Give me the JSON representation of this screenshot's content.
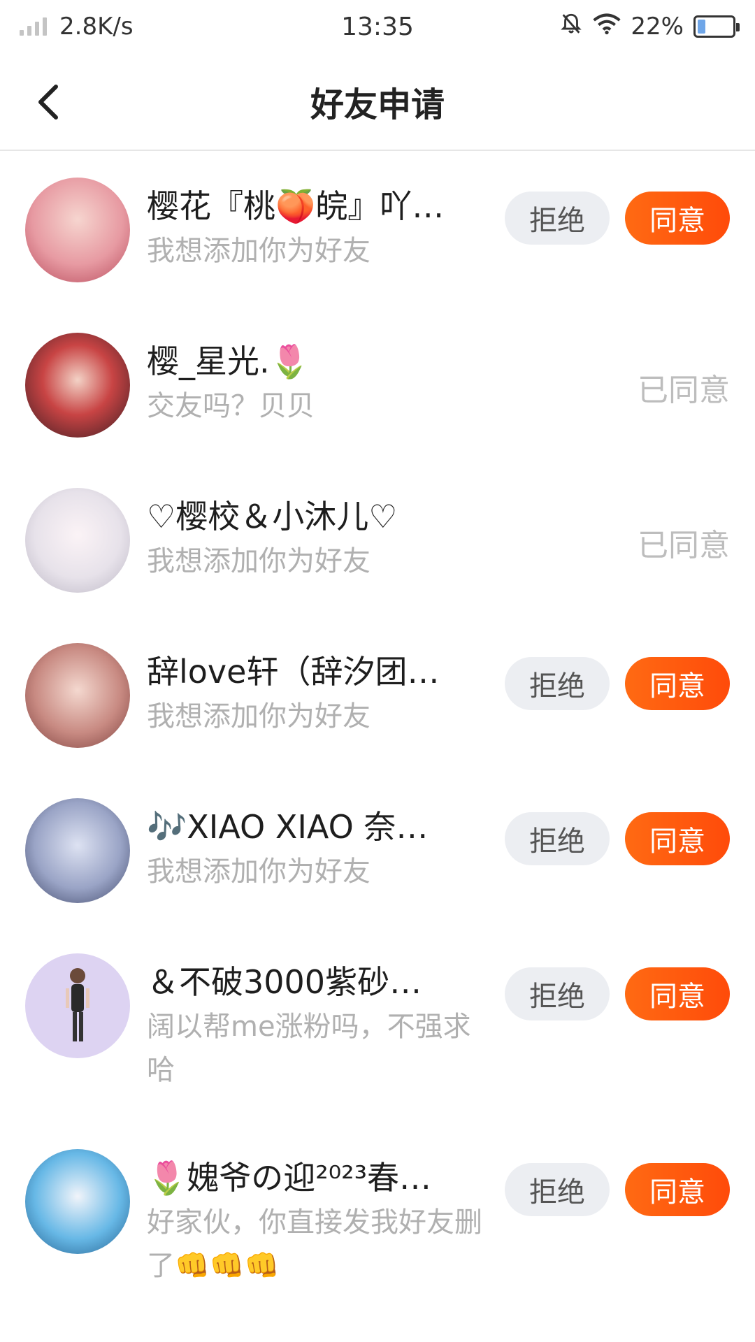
{
  "status_bar": {
    "net_speed": "2.8K/s",
    "time": "13:35",
    "battery_percent": "22%",
    "battery_level": 0.22
  },
  "header": {
    "title": "好友申请"
  },
  "labels": {
    "reject": "拒绝",
    "accept": "同意",
    "accepted": "已同意"
  },
  "requests": [
    {
      "name": "樱花『桃🍑皖』吖…",
      "message": "我想添加你为好友",
      "status": "pending",
      "avatar_color": "#e79aa2"
    },
    {
      "name": "樱_星光.🌷",
      "message": "交友吗？贝贝",
      "status": "accepted",
      "avatar_color": "#b33a3a"
    },
    {
      "name": "♡樱校＆小沐儿♡",
      "message": "我想添加你为好友",
      "status": "accepted",
      "avatar_color": "#e7e2ea"
    },
    {
      "name": "辞love轩（辞汐团…",
      "message": "我想添加你为好友",
      "status": "pending",
      "avatar_color": "#c88a82"
    },
    {
      "name": "🎶XIAO XIAO 奈…",
      "message": "我想添加你为好友",
      "status": "pending",
      "avatar_color": "#9aa4c6"
    },
    {
      "name": "＆不破3000紫砂…",
      "message": "阔以帮me涨粉吗，不强求哈",
      "status": "pending",
      "avatar_color": "#ddd3f2"
    },
    {
      "name": "🌷媿爷の迎²⁰²³春…",
      "message": "好家伙，你直接发我好友删了👊👊👊",
      "status": "pending",
      "avatar_color": "#67b8e6"
    }
  ]
}
